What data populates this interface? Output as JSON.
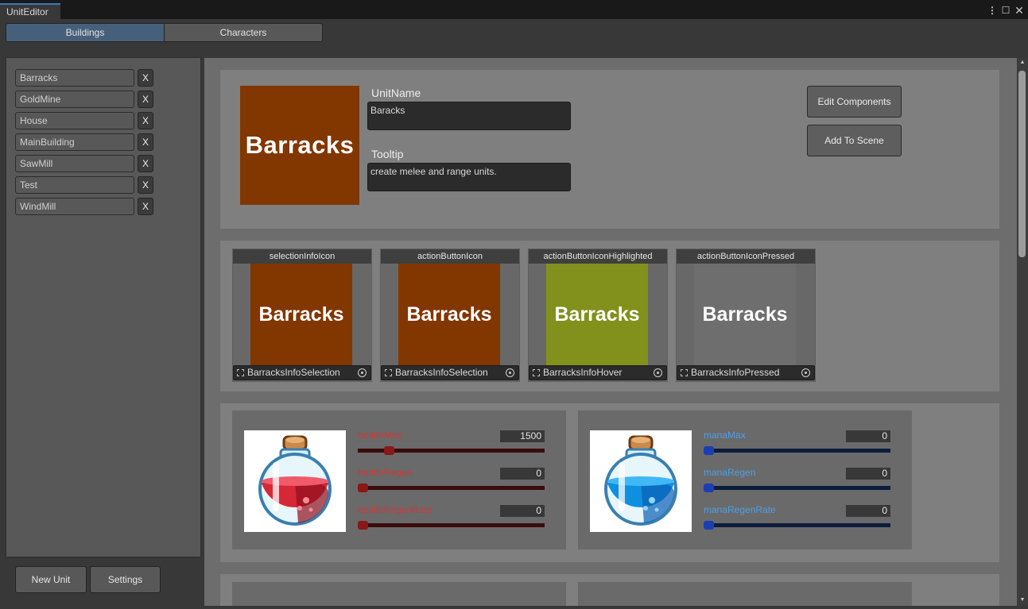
{
  "window": {
    "title": "UnitEditor",
    "menu_glyph": "⋮",
    "max_glyph": "☐",
    "close_glyph": "✕"
  },
  "tabs": [
    "Buildings",
    "Characters"
  ],
  "active_tab": "Buildings",
  "buildings": [
    {
      "name": "Barracks",
      "remove": "X"
    },
    {
      "name": "GoldMine",
      "remove": "X"
    },
    {
      "name": "House",
      "remove": "X"
    },
    {
      "name": "MainBuilding",
      "remove": "X"
    },
    {
      "name": "SawMill",
      "remove": "X"
    },
    {
      "name": "Test",
      "remove": "X"
    },
    {
      "name": "WindMill",
      "remove": "X"
    }
  ],
  "sidebar_buttons": {
    "new_unit": "New Unit",
    "settings": "Settings"
  },
  "unit": {
    "preview_text": "Barracks",
    "unit_name_label": "UnitName",
    "unit_name_value": "Baracks",
    "tooltip_label": "Tooltip",
    "tooltip_value": "create melee and range units.",
    "edit_components": "Edit Components",
    "add_to_scene": "Add To Scene"
  },
  "icons": [
    {
      "title": "selectionInfoIcon",
      "image_text": "Barracks",
      "color": "#823600",
      "asset": "BarracksInfoSelection"
    },
    {
      "title": "actionButtonIcon",
      "image_text": "Barracks",
      "color": "#823600",
      "asset": "BarracksInfoSelection"
    },
    {
      "title": "actionButtonIconHighlighted",
      "image_text": "Barracks",
      "color": "#82911c",
      "asset": "BarracksInfoHover"
    },
    {
      "title": "actionButtonIconPressed",
      "image_text": "Barracks",
      "color": "#6e6e6e",
      "asset": "BarracksInfoPressed"
    }
  ],
  "health": {
    "color": "#d03838",
    "track_color": "#3a0c0c",
    "knob_color": "#8a1818",
    "stats": [
      {
        "label": "healthMax",
        "value": "1500",
        "fraction": 0.15
      },
      {
        "label": "healthRegen",
        "value": "0",
        "fraction": 0
      },
      {
        "label": "healthRegenRate",
        "value": "0",
        "fraction": 0
      }
    ]
  },
  "mana": {
    "color": "#4f9ee6",
    "track_color": "#0c1c3c",
    "knob_color": "#1a3fb5",
    "stats": [
      {
        "label": "manaMax",
        "value": "0",
        "fraction": 0
      },
      {
        "label": "manaRegen",
        "value": "0",
        "fraction": 0
      },
      {
        "label": "manaRegenRate",
        "value": "0",
        "fraction": 0
      }
    ]
  },
  "scroll_glyphs": {
    "up": "▲",
    "down": "▼"
  }
}
